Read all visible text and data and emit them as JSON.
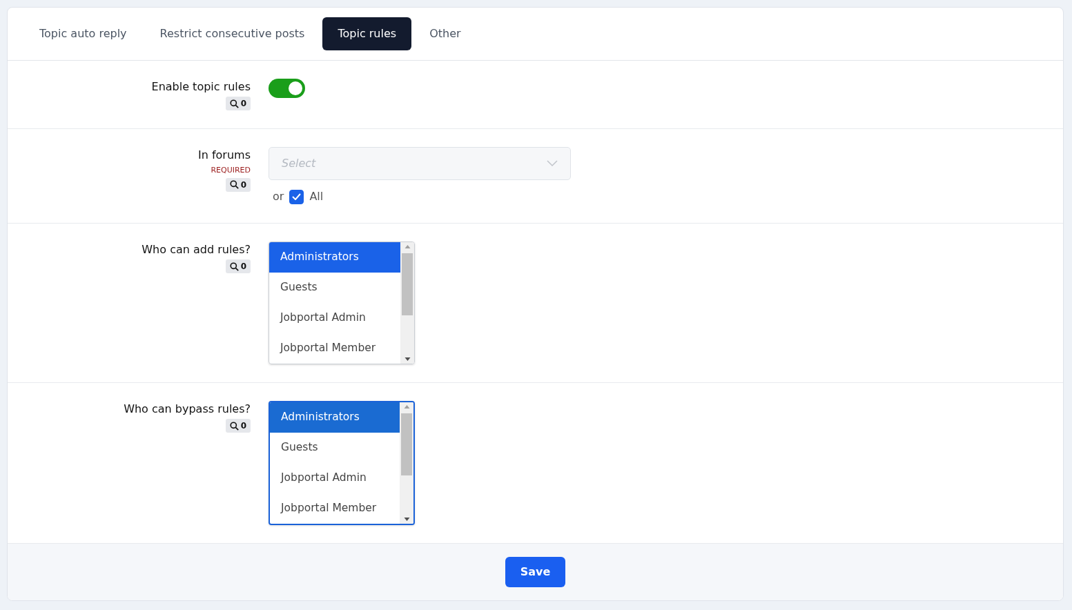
{
  "tabs": [
    {
      "label": "Topic auto reply",
      "selected": false
    },
    {
      "label": "Restrict consecutive posts",
      "selected": false
    },
    {
      "label": "Topic rules",
      "selected": true
    },
    {
      "label": "Other",
      "selected": false
    }
  ],
  "rows": [
    {
      "kind": "toggle",
      "label": "Enable topic rules",
      "search_count": "0",
      "on": true
    },
    {
      "kind": "select",
      "label": "In forums",
      "required": "REQUIRED",
      "search_count": "0",
      "placeholder": "Select",
      "or_text": "or",
      "all_label": "All",
      "all_checked": true
    },
    {
      "kind": "listbox",
      "label": "Who can add rules?",
      "search_count": "0",
      "focused": false,
      "options": [
        {
          "label": "Administrators",
          "selected": true
        },
        {
          "label": "Guests",
          "selected": false
        },
        {
          "label": "Jobportal Admin",
          "selected": false
        },
        {
          "label": "Jobportal Member",
          "selected": false
        }
      ]
    },
    {
      "kind": "listbox",
      "label": "Who can bypass rules?",
      "search_count": "0",
      "focused": true,
      "options": [
        {
          "label": "Administrators",
          "selected": true
        },
        {
          "label": "Guests",
          "selected": false
        },
        {
          "label": "Jobportal Admin",
          "selected": false
        },
        {
          "label": "Jobportal Member",
          "selected": false
        }
      ]
    }
  ],
  "save_button": "Save"
}
